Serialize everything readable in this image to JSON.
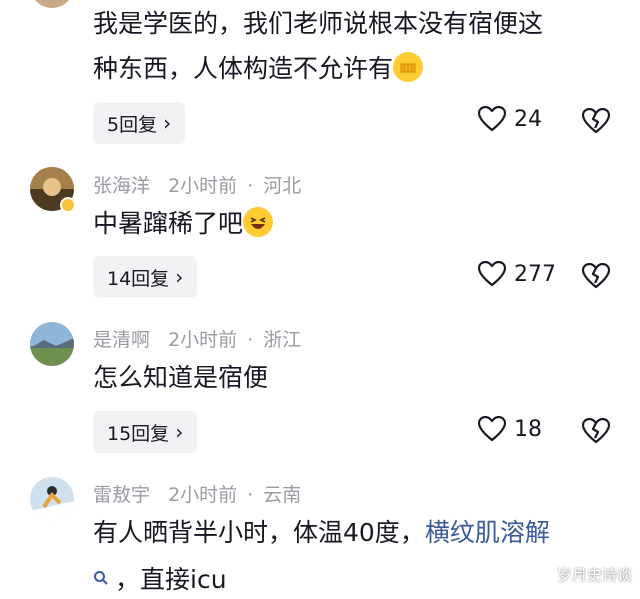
{
  "comments": [
    {
      "text_lines": [
        "我是学医的，我们老师说根本没有宿便这",
        "种东西，人体构造不允许有"
      ],
      "emoji": "fist-bump-icon",
      "reply_label": "5回复",
      "likes": "24"
    },
    {
      "author": "张海洋",
      "time": "2小时前",
      "location": "河北",
      "text": "中暑蹿稀了吧",
      "emoji": "laughing-face-icon",
      "reply_label": "14回复",
      "likes": "277"
    },
    {
      "author": "是清啊",
      "time": "2小时前",
      "location": "浙江",
      "text": "怎么知道是宿便",
      "reply_label": "15回复",
      "likes": "18"
    },
    {
      "author": "雷敖宇",
      "time": "2小时前",
      "location": "云南",
      "text_prefix": "有人晒背半小时，体温40度，",
      "link_text": "横纹肌溶解",
      "text_suffix": "，直接icu"
    }
  ],
  "meta_separator": "·",
  "watermark": "岁月史诗谈",
  "colors": {
    "meta": "#9a9ba3",
    "link": "#3a5a9c",
    "reply_bg": "#f2f2f4"
  }
}
